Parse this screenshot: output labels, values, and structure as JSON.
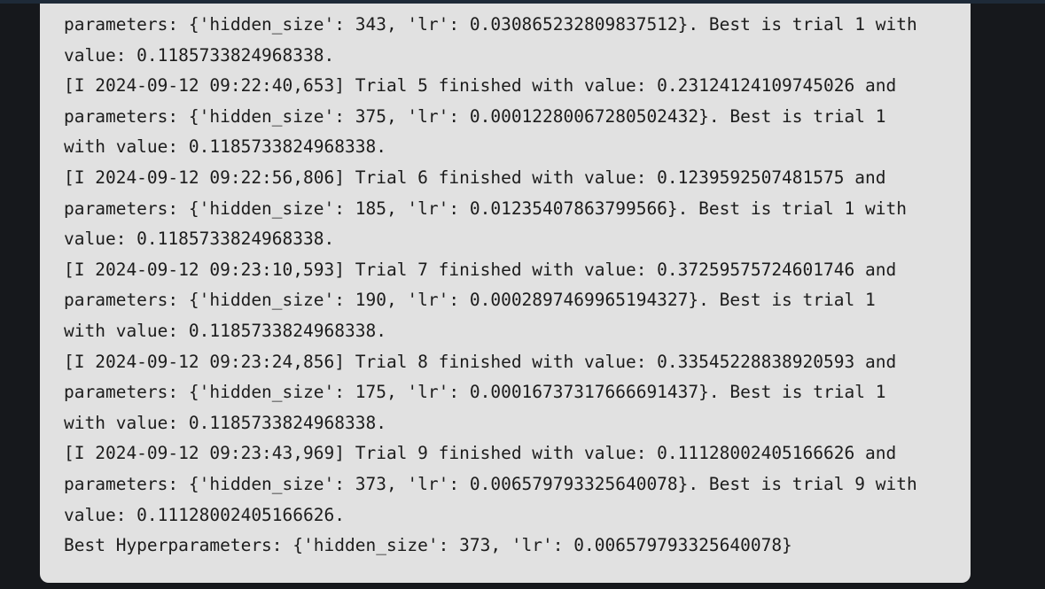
{
  "output": {
    "lines": [
      "parameters: {'hidden_size': 343, 'lr': 0.030865232809837512}. Best is trial 1 with",
      "value: 0.1185733824968338.",
      "[I 2024-09-12 09:22:40,653] Trial 5 finished with value: 0.23124124109745026 and",
      "parameters: {'hidden_size': 375, 'lr': 0.00012280067280502432}. Best is trial 1",
      "with value: 0.1185733824968338.",
      "[I 2024-09-12 09:22:56,806] Trial 6 finished with value: 0.1239592507481575 and",
      "parameters: {'hidden_size': 185, 'lr': 0.01235407863799566}. Best is trial 1 with",
      "value: 0.1185733824968338.",
      "[I 2024-09-12 09:23:10,593] Trial 7 finished with value: 0.37259575724601746 and",
      "parameters: {'hidden_size': 190, 'lr': 0.0002897469965194327}. Best is trial 1",
      "with value: 0.1185733824968338.",
      "[I 2024-09-12 09:23:24,856] Trial 8 finished with value: 0.33545228838920593 and",
      "parameters: {'hidden_size': 175, 'lr': 0.00016737317666691437}. Best is trial 1",
      "with value: 0.1185733824968338.",
      "[I 2024-09-12 09:23:43,969] Trial 9 finished with value: 0.11128002405166626 and",
      "parameters: {'hidden_size': 373, 'lr': 0.006579793325640078}. Best is trial 9 with",
      "value: 0.11128002405166626.",
      "Best Hyperparameters: {'hidden_size': 373, 'lr': 0.006579793325640078}"
    ]
  },
  "colors": {
    "page_background": "#16181c",
    "panel_background": "#e1e1e1",
    "text": "#1c1c1c"
  }
}
